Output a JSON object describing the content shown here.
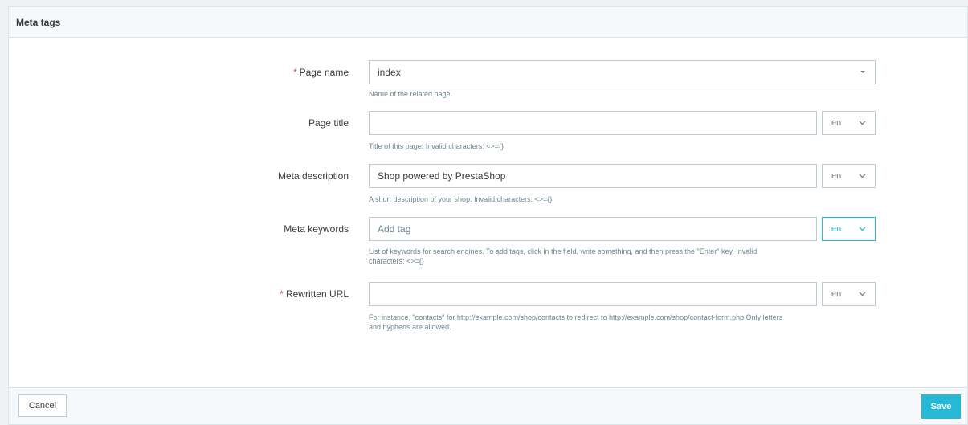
{
  "panel": {
    "title": "Meta tags"
  },
  "fields": {
    "page_name": {
      "required_mark": "*",
      "label": "Page name",
      "value": "index",
      "help": "Name of the related page."
    },
    "page_title": {
      "label": "Page title",
      "value": "",
      "lang": "en",
      "help": "Title of this page. Invalid characters: <>={}"
    },
    "meta_description": {
      "label": "Meta description",
      "value": "Shop powered by PrestaShop",
      "lang": "en",
      "help": "A short description of your shop. Invalid characters: <>={}"
    },
    "meta_keywords": {
      "label": "Meta keywords",
      "placeholder": "Add tag",
      "lang": "en",
      "help_line1": "List of keywords for search engines. To add tags, click in the field, write something, and then press the \"Enter\" key. Invalid",
      "help_line2": "characters: <>={}"
    },
    "rewritten_url": {
      "required_mark": "*",
      "label": "Rewritten URL",
      "value": "",
      "lang": "en",
      "help_line1": "For instance, \"contacts\" for http://example.com/shop/contacts to redirect to http://example.com/shop/contact-form.php Only letters",
      "help_line2": "and hyphens are allowed."
    }
  },
  "footer": {
    "cancel_label": "Cancel",
    "save_label": "Save"
  },
  "colors": {
    "accent": "#25b9d7",
    "required": "#c05c67",
    "border": "#bbcdd2"
  }
}
